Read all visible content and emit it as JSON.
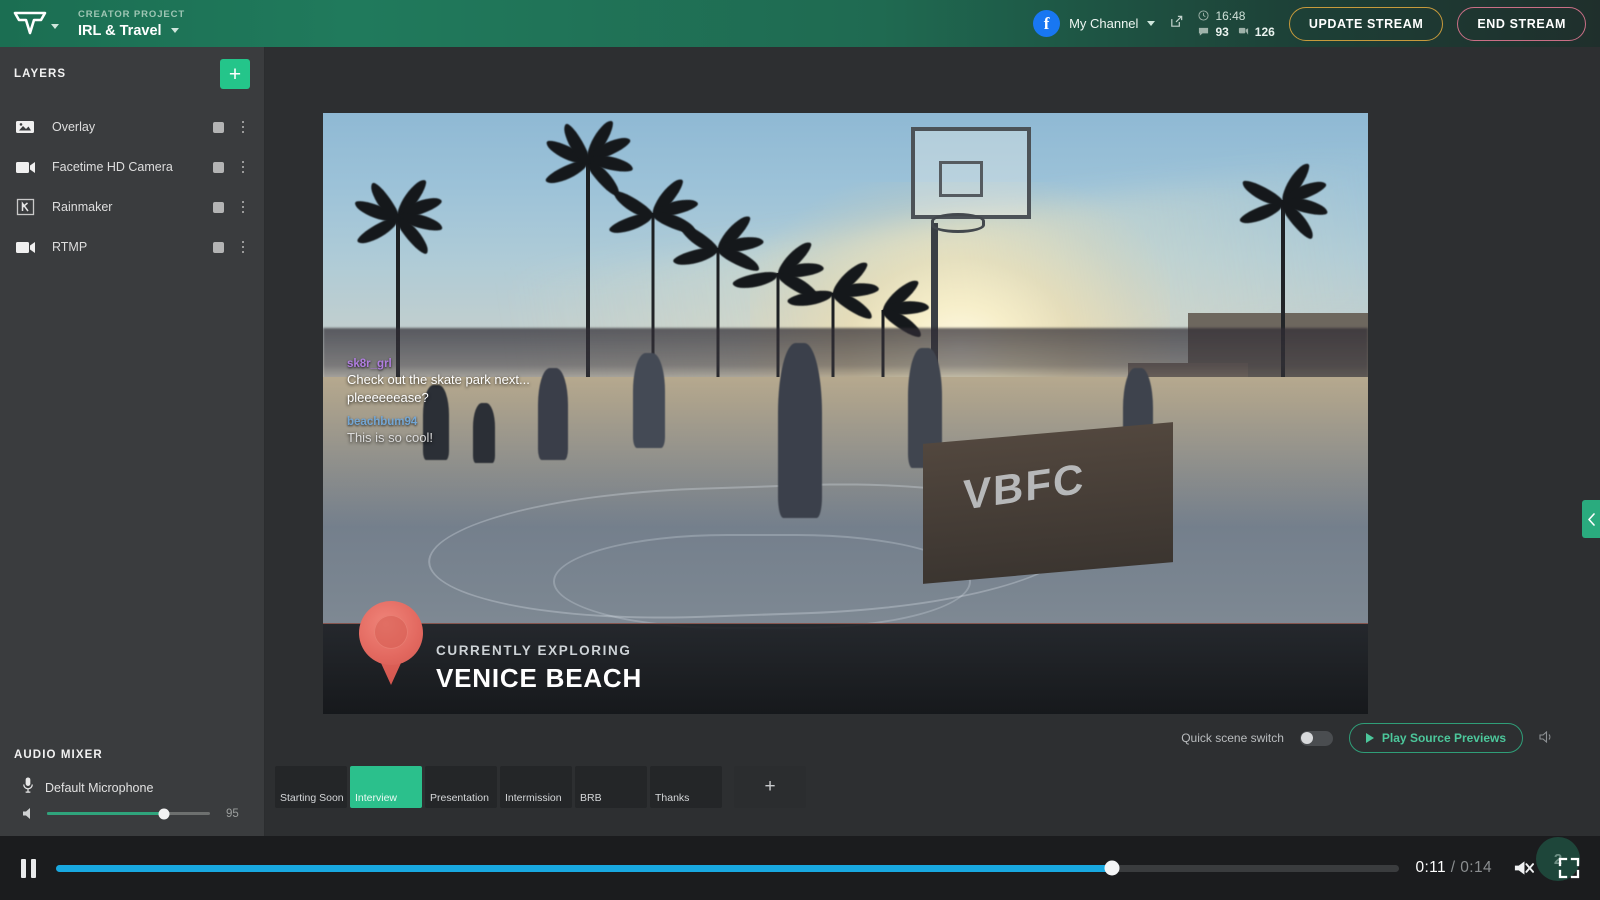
{
  "topbar": {
    "logo_name": "app-logo",
    "project_kicker": "CREATOR PROJECT",
    "project_name": "IRL & Travel",
    "channel_name": "My Channel",
    "channel_initial": "f",
    "clock": "16:48",
    "comments_count": "93",
    "viewers_count": "126",
    "update_stream_label": "UPDATE STREAM",
    "end_stream_label": "END STREAM",
    "accent_update": "#c79a3c",
    "accent_end": "#c96f86"
  },
  "sidebar": {
    "layers_title": "LAYERS",
    "add_label": "+",
    "items": [
      {
        "label": "Overlay",
        "icon": "image-icon"
      },
      {
        "label": "Facetime HD Camera",
        "icon": "camera-icon"
      },
      {
        "label": "Rainmaker",
        "icon": "rainmaker-icon"
      },
      {
        "label": "RTMP",
        "icon": "camera-icon"
      }
    ],
    "mixer_title": "AUDIO MIXER",
    "mic_label": "Default Microphone",
    "volume_value": "95",
    "volume_percent": 72,
    "mixer_accent": "#2fa47c"
  },
  "stage": {
    "chat": [
      {
        "user": "sk8r_grl",
        "lines": [
          "Check out the skate park next...",
          "pleeeeeease?"
        ],
        "color": "#b07de0"
      },
      {
        "user": "beachbum94",
        "lines": [
          "This is so cool!"
        ],
        "color": "#6fa8dc"
      }
    ],
    "lower_third": {
      "kicker": "CURRENTLY EXPLORING",
      "title": "VENICE BEACH",
      "pin_color": "#e2685f"
    },
    "sign_text": "VBFC",
    "quick_scene_switch_label": "Quick scene switch",
    "quick_scene_switch_on": false,
    "play_source_previews_label": "Play Source Previews",
    "scenes": [
      {
        "label": "Starting Soon",
        "active": false
      },
      {
        "label": "Interview",
        "active": true
      },
      {
        "label": "Presentation",
        "active": false
      },
      {
        "label": "Intermission",
        "active": false
      },
      {
        "label": "BRB",
        "active": false
      },
      {
        "label": "Thanks",
        "active": false
      }
    ],
    "add_scene_label": "+",
    "active_accent": "#2bc08c"
  },
  "player": {
    "state": "playing",
    "current_time": "0:11",
    "separator": "/",
    "total_time": "0:14",
    "progress_percent": 78.6,
    "progress_color": "#18a8e0",
    "muted": true,
    "badge_count": "2"
  }
}
